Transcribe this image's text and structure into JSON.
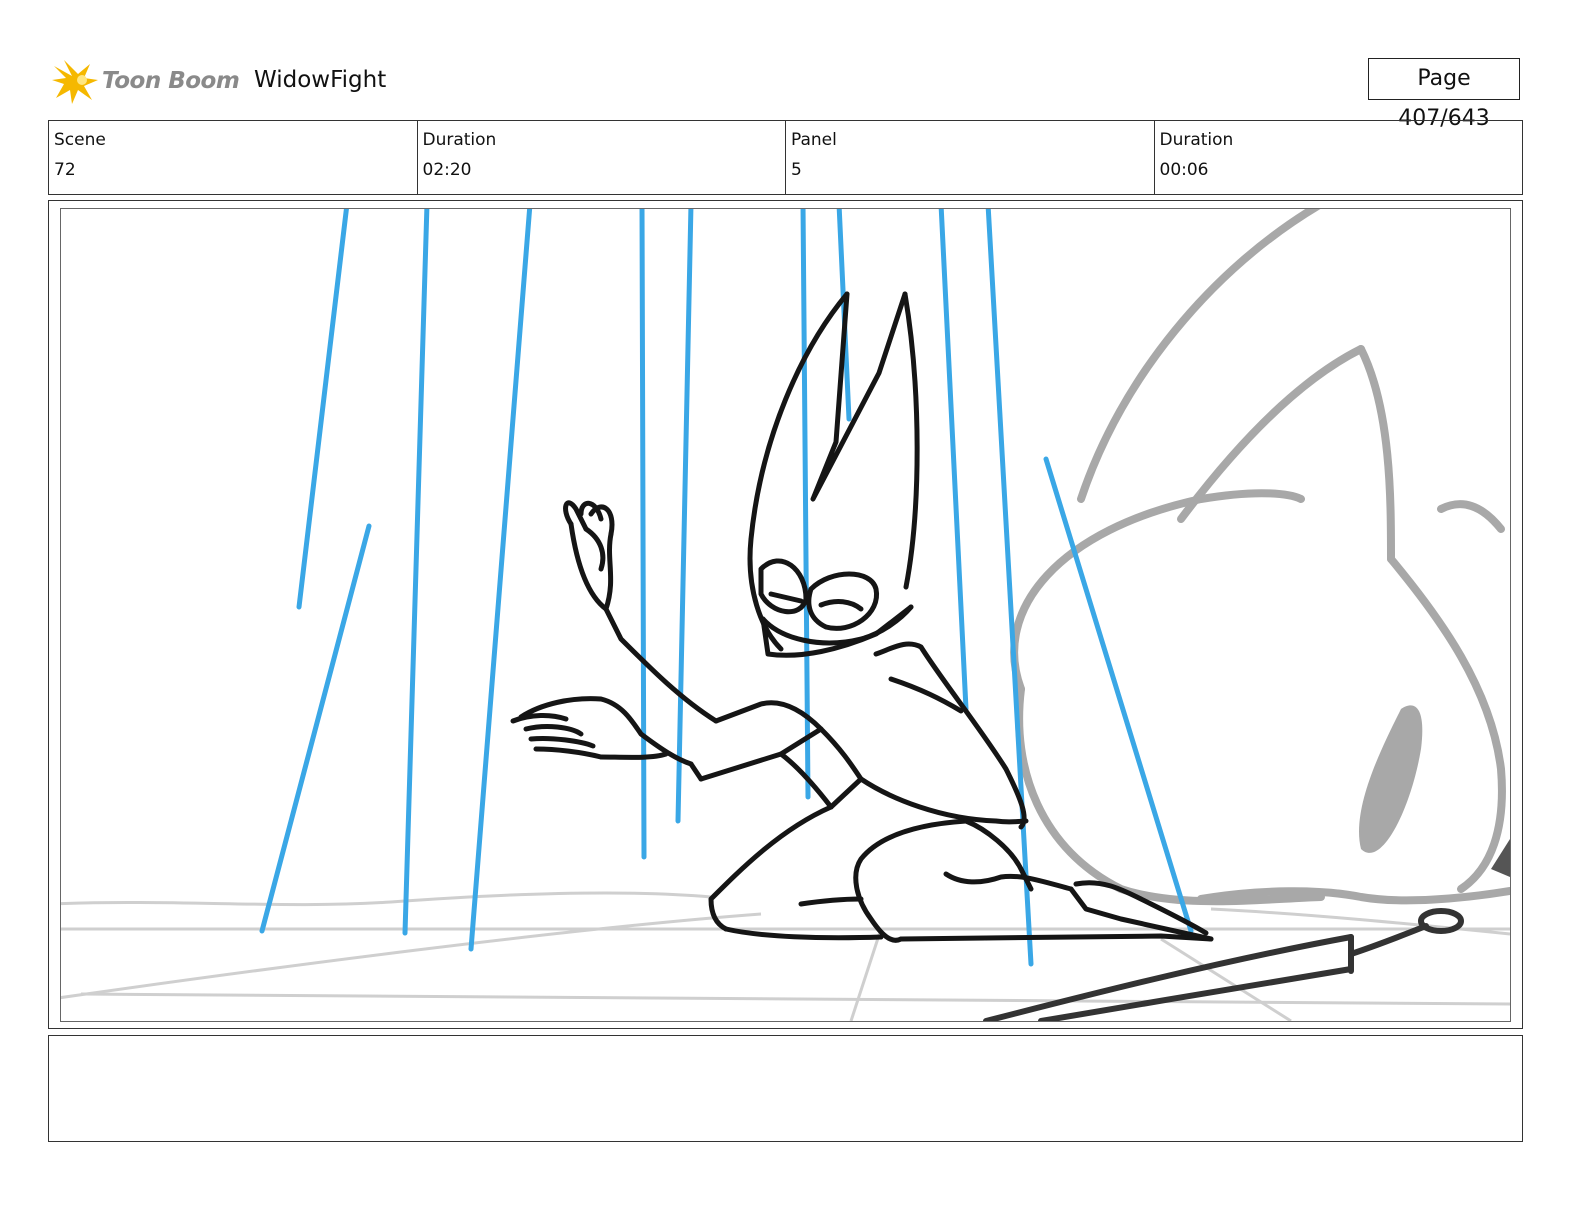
{
  "header": {
    "logo_text": "Toon Boom",
    "project_title": "WidowFight",
    "page_label": "Page 407/643"
  },
  "info": {
    "scene_label": "Scene",
    "scene_value": "72",
    "scene_duration_label": "Duration",
    "scene_duration_value": "02:20",
    "panel_label": "Panel",
    "panel_value": "5",
    "panel_duration_label": "Duration",
    "panel_duration_value": "00:06"
  },
  "panel": {
    "image_icon": "storyboard-sketch-image",
    "colors": {
      "rain": "#3aa7e6",
      "ink": "#151515",
      "background_figure": "#a8a8a8",
      "floor": "#cfcfcf"
    }
  },
  "notes": {
    "text": ""
  },
  "colors": {
    "logo_star": "#f5b800",
    "logo_text": "#8a8a8a",
    "border": "#333333"
  }
}
